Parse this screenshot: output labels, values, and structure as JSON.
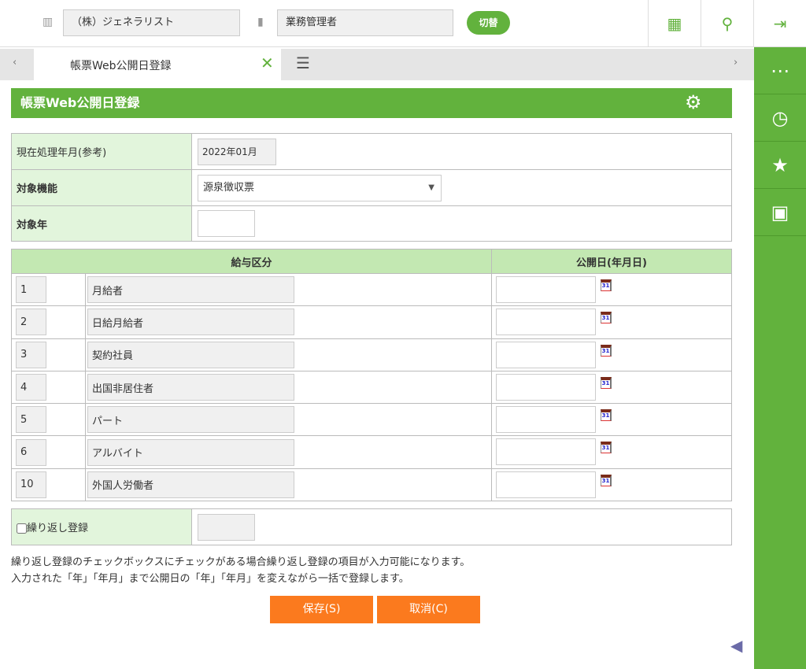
{
  "header": {
    "company": "（株）ジェネラリスト",
    "role": "業務管理者",
    "switch_label": "切替"
  },
  "tabs": [
    {
      "label": "帳票Web公開日登録"
    }
  ],
  "page_title": "帳票Web公開日登録",
  "form": {
    "processing_month_label": "現在処理年月(参考)",
    "processing_month_value": "2022年01月",
    "function_label": "対象機能",
    "function_value": "源泉徴収票",
    "year_label": "対象年",
    "year_value": ""
  },
  "grid": {
    "headers": [
      "給与区分",
      "公開日(年月日)"
    ],
    "rows": [
      {
        "code": "1",
        "name": "月給者",
        "date": ""
      },
      {
        "code": "2",
        "name": "日給月給者",
        "date": ""
      },
      {
        "code": "3",
        "name": "契約社員",
        "date": ""
      },
      {
        "code": "4",
        "name": "出国非居住者",
        "date": ""
      },
      {
        "code": "5",
        "name": "パート",
        "date": ""
      },
      {
        "code": "6",
        "name": "アルバイト",
        "date": ""
      },
      {
        "code": "10",
        "name": "外国人労働者",
        "date": ""
      }
    ]
  },
  "repeat": {
    "label": "繰り返し登録",
    "checked": false,
    "value": ""
  },
  "notes": [
    "繰り返し登録のチェックボックスにチェックがある場合繰り返し登録の項目が入力可能になります。",
    "入力された「年」「年月」まで公開日の「年」「年月」を変えながら一括で登録します。"
  ],
  "buttons": {
    "save": "保存(S)",
    "cancel": "取消(C)"
  },
  "calendar_icon_text": "31",
  "colors": {
    "green": "#62b23d",
    "orange": "#fb7a1e",
    "label_bg": "#e2f5dc",
    "header_bg": "#c3e8b2"
  }
}
